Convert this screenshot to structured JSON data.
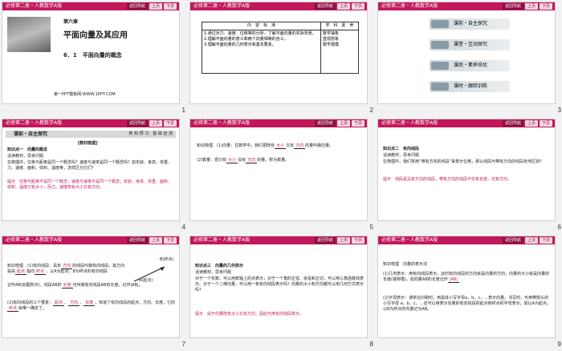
{
  "header": {
    "course": "必修第二册・人教数学A版",
    "nav_home": "返回导航",
    "nav_prev": "上页",
    "nav_next": "下页"
  },
  "slides": [
    {
      "number": "1",
      "chapter": "第六章",
      "title": "平面向量及其应用",
      "section": "6．1　平面向量的概念",
      "footer": "第一PPT模板网-WWW.1PPT.COM"
    },
    {
      "number": "2",
      "col1": "内　容　标　准",
      "col2": "学　科　素　养",
      "rows": [
        "1.通过对力、速度、位移等的分析，了解平面向量的实际背景。",
        "2.理解平面向量的意义和两个向量相等的含义。",
        "3.理解平面向量的几何表示和基本要素。"
      ],
      "skills": [
        "数学抽象",
        "直观想象",
        "数学建模"
      ]
    },
    {
      "number": "3",
      "menu": [
        "课前・自主探究",
        "课堂・互动探究",
        "课后・素养培优",
        "课时・跟踪训练"
      ]
    },
    {
      "number": "4",
      "bar": "课前・自主探究",
      "bar_right": "新 知 预 习　基 础 自 测",
      "tag": "[教材梳理]",
      "point": "知识点一　向量的概念",
      "read": "话读教材，思考问题",
      "text1": "在物理中，位移与距离是同一个概念吗？速度与速率是同一个概念吗？如年龄、身高、体重、力、速度、面积、体积、温度等，怎样区分它们？",
      "tip": "提示",
      "text2": "位移与距离不是同一个概念；速度与速率不是同一个概念；年龄、身高、体重、面积、体积、温度只有大小，而力、速度既有大小又有方向。"
    },
    {
      "number": "5",
      "text1": "知识梳理　(1)向量：在数学中，我们把既有",
      "blank1": "大小",
      "text1b": "又有",
      "blank2": "方向",
      "text1c": "的量叫做向量。",
      "text2": "(2)数量：把只有",
      "blank3": "大小",
      "text2b": "没有",
      "blank4": "方向",
      "text2c": "的量，称为数量。"
    },
    {
      "number": "6",
      "point": "知识点二　有向线段",
      "read": "话读教材，思考问题",
      "text1": "在物理中，我们常用“带有方向的线段”来表示位移，那么线段与带有方向的线段有何区别？",
      "tip": "提示",
      "text2": "线段是没有方向的线段，带有方向的线段不仅有长度，还有方向。"
    },
    {
      "number": "7",
      "text1": "知识梳理　(1)有向线段：具有",
      "blank1": "方向",
      "text1b": "的线段叫做有向线段，其方向是由",
      "blank2": "起点",
      "text1c": "指向",
      "blank3": "终点",
      "text1d": "。以A为起点，B为终点的有向线段",
      "text2": "记作AB(如图所示)，线段AB的",
      "blank4": "长度",
      "text2b": "也叫做有向线段AB的长度，记作|AB|。",
      "text3": "(2)有向线段的三个要素：",
      "blank5": "起点",
      "blank6": "方向",
      "blank7": "长度",
      "text3b": "，知道了有向线段的起点、方向、长度，它的",
      "blank8": "终点",
      "text3c": "就唯一确定了。",
      "label_end": "B(终点)",
      "label_start": "A(起点)"
    },
    {
      "number": "8",
      "point": "知识点三　向量的几何表示",
      "read": "话读教材，思考问题",
      "text1": "对于一个实数，可以用数轴上的点表示；对于一个角的正弦、余弦和正切，可以用三角函数线表示。对于一个二维向量，可以用一条有向线段表示吗？向量的大小和方向都可以用几何方式表示吗？",
      "tip": "提示",
      "text2": "由于向量既有大小又有方向，因此可用有向线段表示。"
    },
    {
      "number": "9",
      "text1": "知识梳理　向量的表示法",
      "text2": "(1)几何表示：用有向线段表示，此时有向线段的方向就是向量的方向，向量的大小就是向量的长度(或称模)，如向量AB的长度记作",
      "blank1": "|AB|",
      "text3": "(2)字母表示：通常在印刷时，用黑体小写字母a，b，c，…表示向量，书写时，可用带箭头的小写字母 a，b，c，…还可以用表示向量的有向线段的起点和终点的字母表示，如以A为起点，以B为终点的向量记为AB。"
    }
  ]
}
